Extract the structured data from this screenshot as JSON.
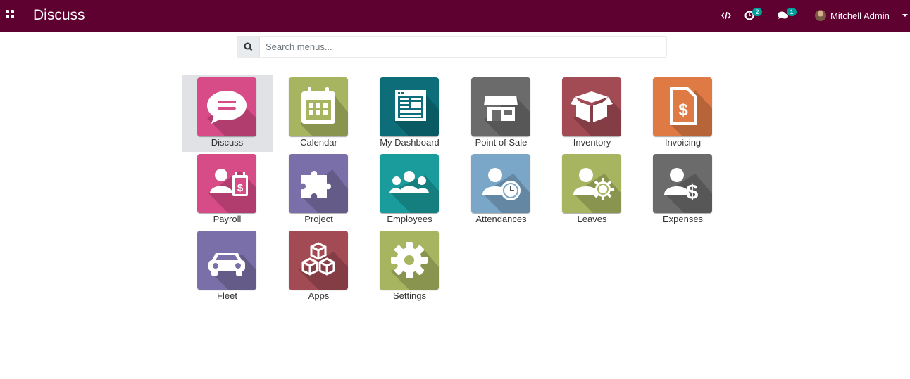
{
  "navbar": {
    "title": "Discuss",
    "activity_count": "2",
    "message_count": "1",
    "user_name": "Mitchell Admin",
    "bg_color": "#5e0030"
  },
  "search": {
    "placeholder": "Search menus..."
  },
  "apps": [
    {
      "label": "Discuss",
      "icon": "chat-bubble-icon",
      "color": "#d74b86"
    },
    {
      "label": "Calendar",
      "icon": "calendar-icon",
      "color": "#a8b560"
    },
    {
      "label": "My Dashboard",
      "icon": "dashboard-icon",
      "color": "#0d6e7a"
    },
    {
      "label": "Point of Sale",
      "icon": "store-icon",
      "color": "#6b6b6b"
    },
    {
      "label": "Inventory",
      "icon": "box-icon",
      "color": "#a34b55"
    },
    {
      "label": "Invoicing",
      "icon": "invoice-icon",
      "color": "#e07a45"
    },
    {
      "label": "Payroll",
      "icon": "payroll-icon",
      "color": "#d74b86"
    },
    {
      "label": "Project",
      "icon": "puzzle-icon",
      "color": "#7a6fa8"
    },
    {
      "label": "Employees",
      "icon": "users-icon",
      "color": "#1a9b9c"
    },
    {
      "label": "Attendances",
      "icon": "user-clock-icon",
      "color": "#7aa7c7"
    },
    {
      "label": "Leaves",
      "icon": "user-sun-icon",
      "color": "#a8b560"
    },
    {
      "label": "Expenses",
      "icon": "user-dollar-icon",
      "color": "#6b6b6b"
    },
    {
      "label": "Fleet",
      "icon": "car-icon",
      "color": "#7a6fa8"
    },
    {
      "label": "Apps",
      "icon": "cubes-icon",
      "color": "#a34b55"
    },
    {
      "label": "Settings",
      "icon": "gear-icon",
      "color": "#a8b560"
    }
  ]
}
